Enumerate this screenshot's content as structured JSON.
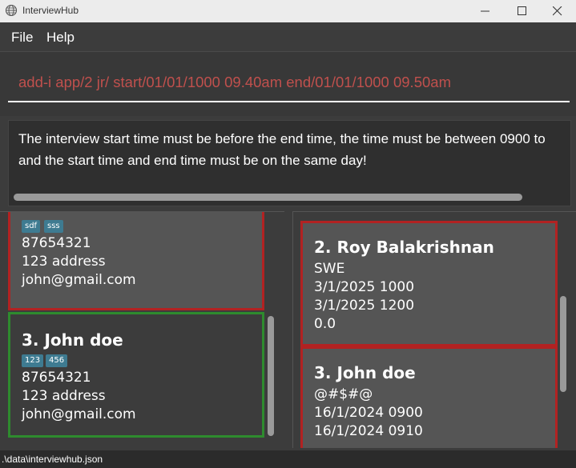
{
  "window": {
    "title": "InterviewHub"
  },
  "menu": {
    "file": "File",
    "help": "Help"
  },
  "command": {
    "value": "add-i app/2 jr/ start/01/01/1000 09.40am end/01/01/1000 09.50am"
  },
  "result": {
    "line1": "The interview start time must be before the end time, the time must be between 0900 to",
    "line2": "and the start time and end time must be on the same day!"
  },
  "applicants": [
    {
      "name": "",
      "tags": [
        "sdf",
        "sss"
      ],
      "phone": "87654321",
      "address": "123 address",
      "email": "john@gmail.com"
    },
    {
      "name": "3.  John doe",
      "tags": [
        "123",
        "456"
      ],
      "phone": "87654321",
      "address": "123 address",
      "email": "john@gmail.com"
    }
  ],
  "interviews": [
    {
      "name": "2.  Roy Balakrishnan",
      "role": "SWE",
      "start": "3/1/2025 1000",
      "end": "3/1/2025 1200",
      "rating": "0.0"
    },
    {
      "name": "3.  John doe",
      "role": "@#$#@",
      "start": "16/1/2024 0900",
      "end": "16/1/2024 0910"
    }
  ],
  "status": {
    "path": ".\\data\\interviewhub.json"
  },
  "colors": {
    "selected_border": "#2e8b2e",
    "card_border": "#b22222",
    "command_text": "#c0504d",
    "tag_bg": "#3e7b91"
  }
}
